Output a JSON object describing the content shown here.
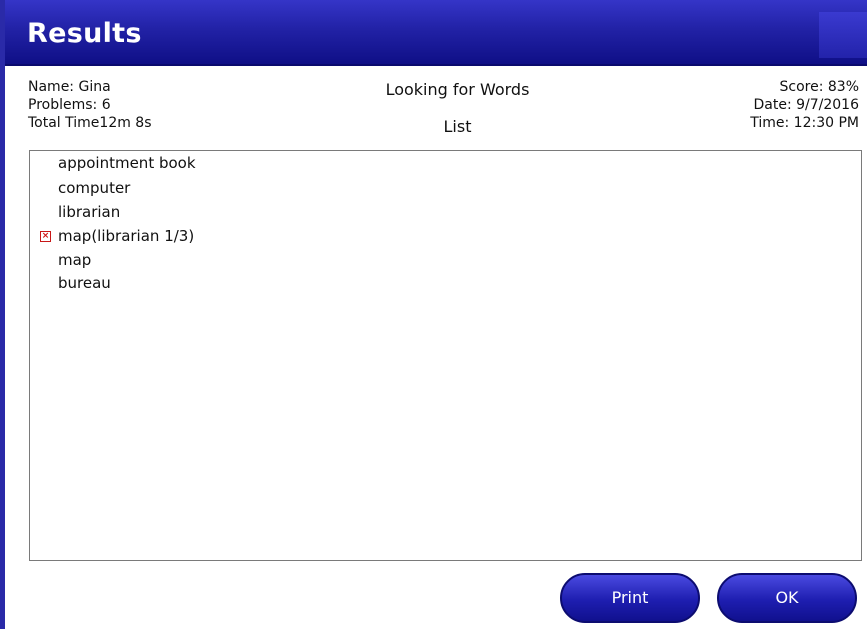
{
  "window": {
    "title": "Results"
  },
  "summary": {
    "name": "Name: Gina",
    "problems": "Problems: 6",
    "total_time": "Total Time12m 8s",
    "activity": "Looking for Words",
    "mode": "List",
    "score": "Score: 83%",
    "date": "Date: 9/7/2016",
    "time": "Time: 12:30 PM"
  },
  "results_list": {
    "items": [
      {
        "text": "appointment book",
        "incorrect": false
      },
      {
        "text": "computer",
        "incorrect": false
      },
      {
        "text": "librarian",
        "incorrect": false
      },
      {
        "text": "map(librarian 1/3)",
        "incorrect": true
      },
      {
        "text": "map",
        "incorrect": false
      },
      {
        "text": "bureau",
        "incorrect": false
      }
    ],
    "error_icon": "x-mark-icon",
    "error_color": "#d01010"
  },
  "buttons": {
    "print_label": "Print",
    "ok_label": "OK"
  },
  "colors": {
    "title_bar": "#2222a6",
    "button": "#1e1eb0"
  }
}
